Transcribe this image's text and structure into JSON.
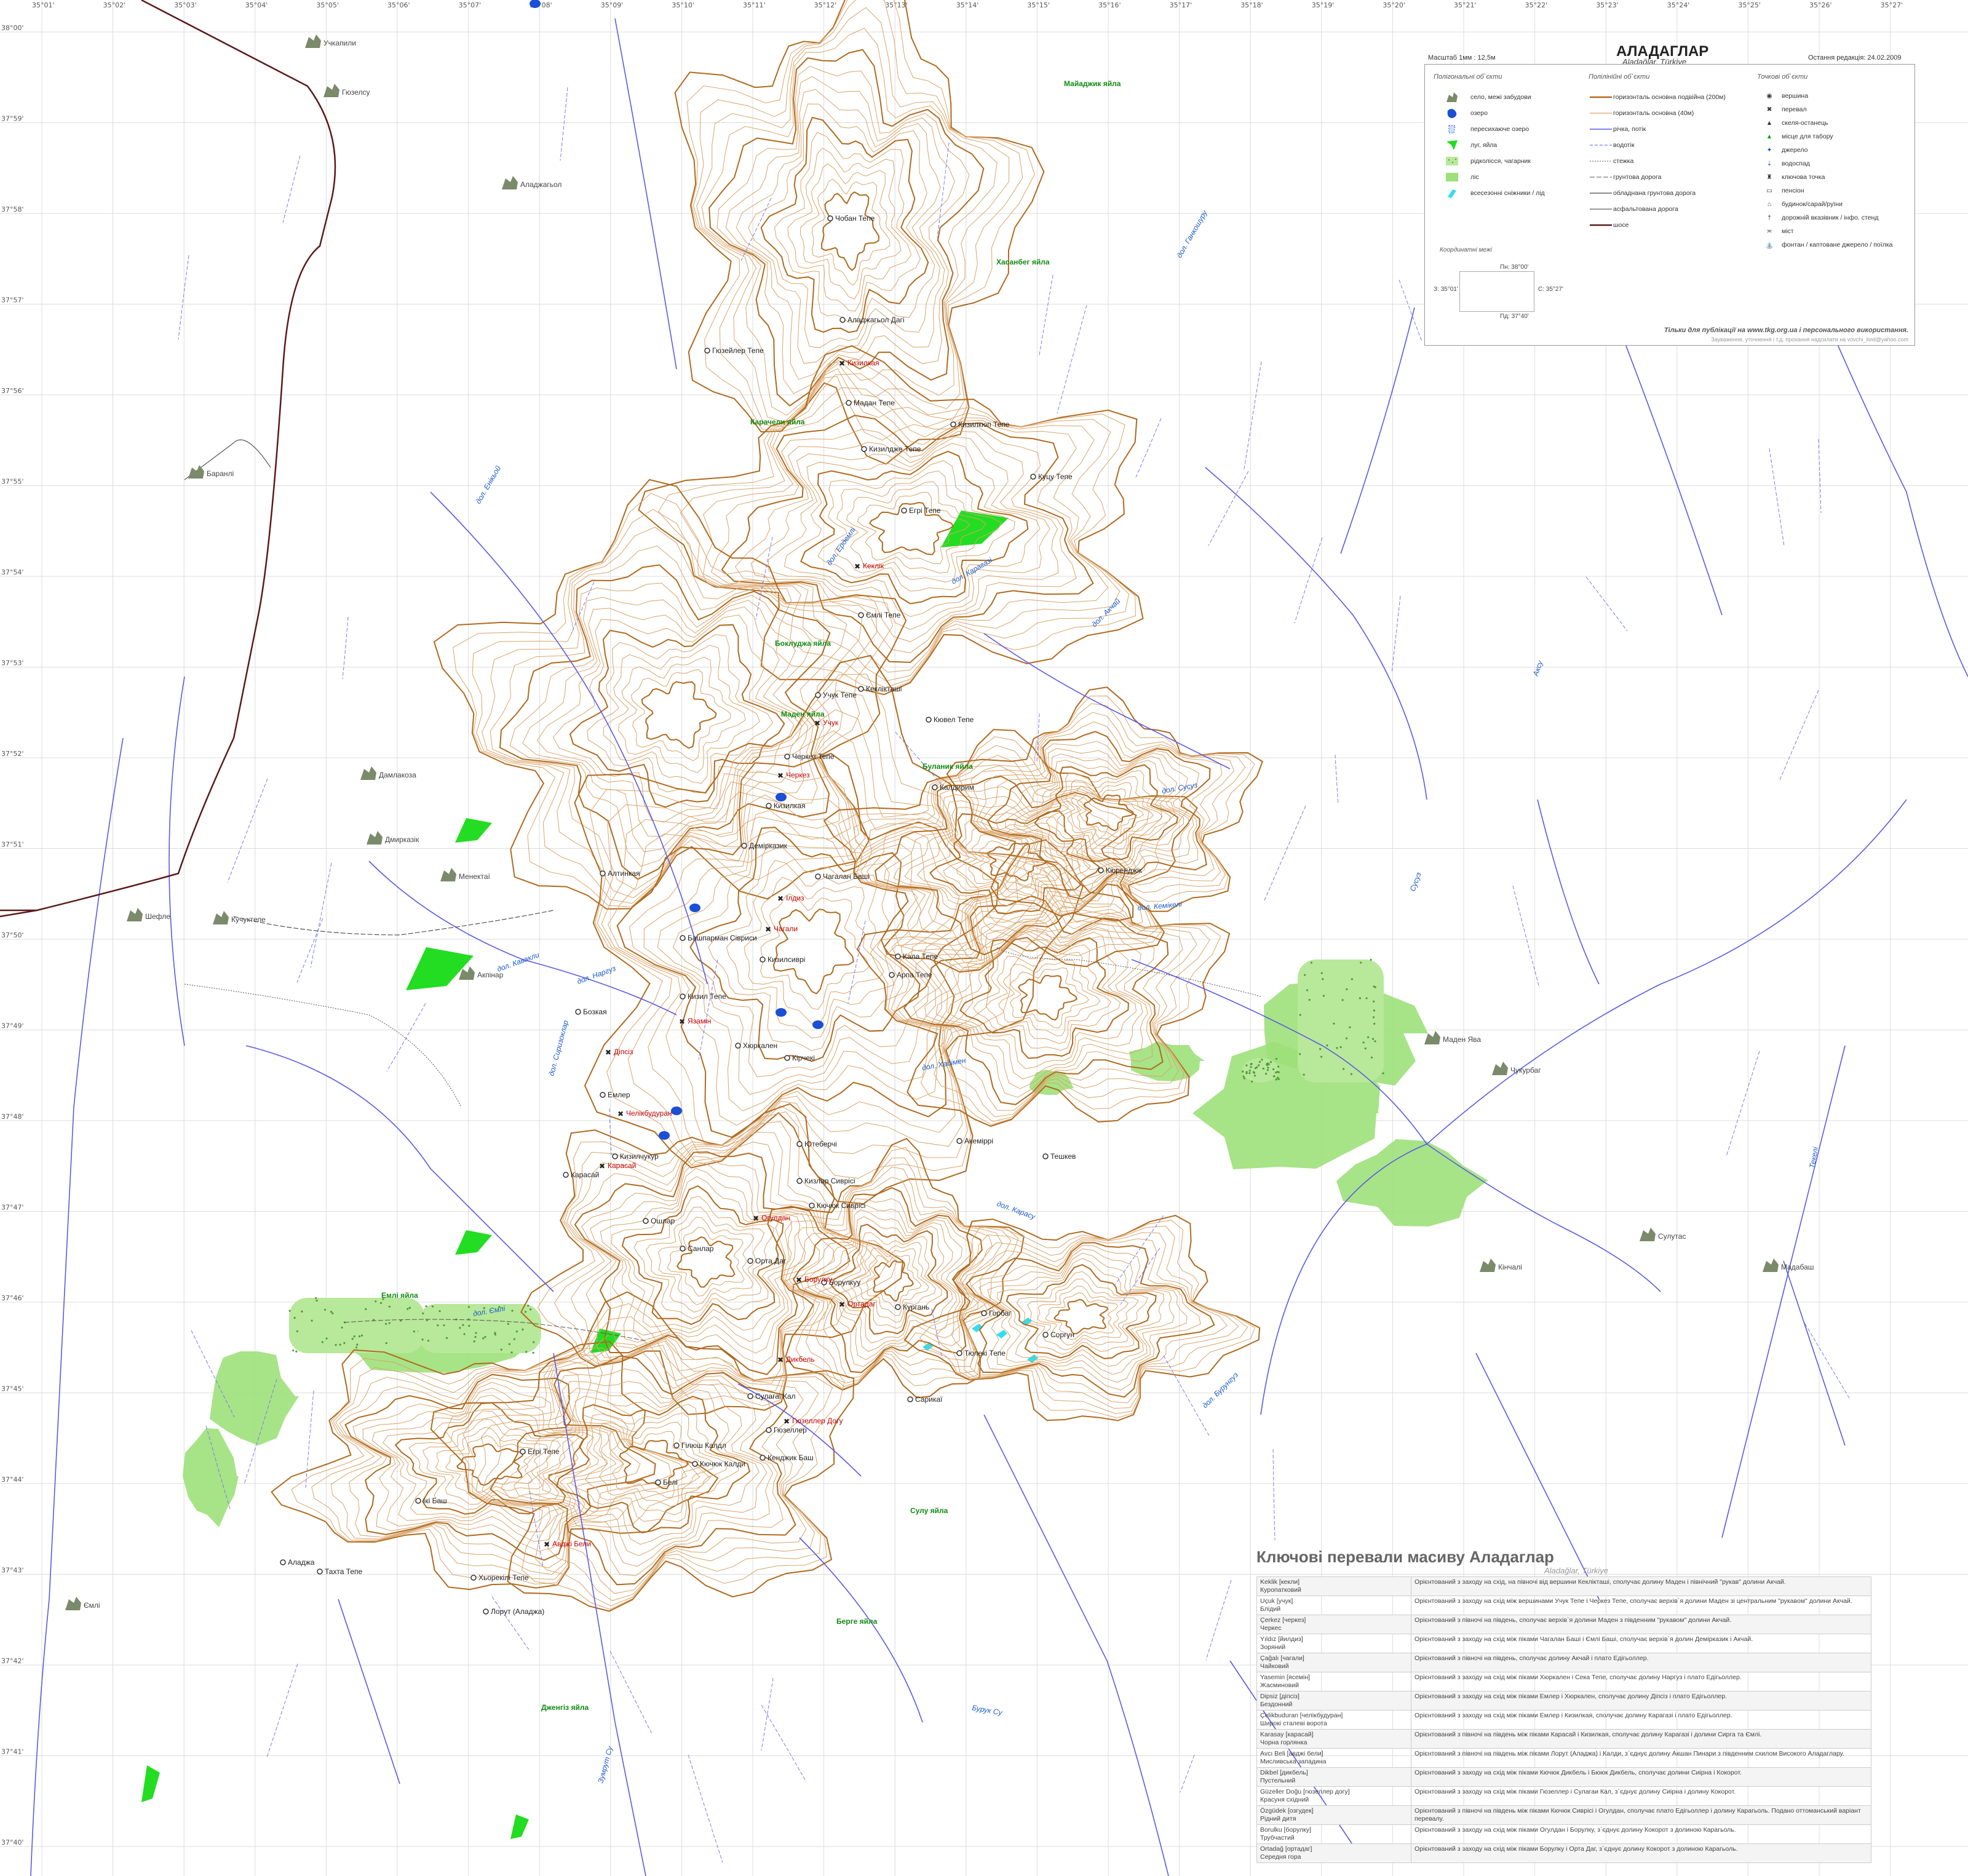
{
  "map": {
    "title": "АЛАДАГЛАР",
    "subtitle": "Aladağlar, Türkiye",
    "scale": "Масштаб 1мм : 12,5м",
    "last_edit": "Остання редакція: 24.02.2009"
  },
  "grid": {
    "top_labels": [
      "35°01'",
      "35°02'",
      "35°03'",
      "35°04'",
      "35°05'",
      "35°06'",
      "35°07'",
      "35°08'",
      "35°09'",
      "35°10'",
      "35°11'",
      "35°12'",
      "35°13'",
      "35°14'",
      "35°15'",
      "35°16'",
      "35°17'",
      "35°18'",
      "35°19'",
      "35°20'",
      "35°21'",
      "35°22'",
      "35°23'",
      "35°24'",
      "35°25'",
      "35°26'",
      "35°27'"
    ],
    "left_labels": [
      "38°00'",
      "37°59'",
      "37°58'",
      "37°57'",
      "37°56'",
      "37°55'",
      "37°54'",
      "37°53'",
      "37°52'",
      "37°51'",
      "37°50'",
      "37°49'",
      "37°48'",
      "37°47'",
      "37°46'",
      "37°45'",
      "37°44'",
      "37°43'",
      "37°42'",
      "37°41'",
      "37°40'"
    ]
  },
  "legend": {
    "polygon_head": "Полігональні об`єкти",
    "line_head": "Полілінійні об`єкти",
    "point_head": "Точкові об`єкти",
    "polygon_items": [
      "село, межі забудови",
      "озеро",
      "пересихаюче озеро",
      "луг, яйла",
      "рідколісся, чагарник",
      "ліс",
      "всесезонні сніжники / лід"
    ],
    "line_items": [
      "горизонталь основна подвійна (200м)",
      "горизонталь основна (40м)",
      "річка, потік",
      "водотік",
      "стежка",
      "грунтова дорога",
      "обладнана грунтова дорога",
      "асфальтована дорога",
      "шосе"
    ],
    "point_items": [
      "вершина",
      "перевал",
      "скеля-останець",
      "місце для табору",
      "джерело",
      "водоспад",
      "ключова точка",
      "пенсіон",
      "будинок/сарай/руїни",
      "дорожній вказівник / інфо. стенд",
      "міст",
      "фонтан / каптоване джерело / поїлка"
    ],
    "coord_head": "Координатні межі",
    "coord_n": "Пн: 38°00'",
    "coord_w": "З: 35°01'",
    "coord_e": "С: 35°27'",
    "coord_s": "Пд: 37°40'",
    "footer1": "Тільки для публікації на www.tkg.org.ua і персонального використання.",
    "footer2": "Зауваження, уточнення і т.д. прохання надсилати на vovchi_livid@yahoo.com",
    "colors": {
      "contour_major": "#b06a1e",
      "contour_minor": "#d9a46a",
      "river": "#5a5ae6",
      "stream": "#7a7af0",
      "highway": "#5a1a1a",
      "meadow": "#22dd22",
      "forest": "#9de07a",
      "shrub": "#b8e89a",
      "lake": "#1a4fd6",
      "snow": "#33ddee"
    }
  },
  "peaks": [
    {
      "name": "Чобан Тепе"
    },
    {
      "name": "Аладжагьол Дагі"
    },
    {
      "name": "Гюзейлер Тепе"
    },
    {
      "name": "Мадан Тепе"
    },
    {
      "name": "Кизилкюп Тепе"
    },
    {
      "name": "Кизилдже Тепе"
    },
    {
      "name": "Куцу Тепе"
    },
    {
      "name": "Егрі Тепе"
    },
    {
      "name": "Ємлі Тепе"
    },
    {
      "name": "Кеклікташі"
    },
    {
      "name": "Учук Тепе"
    },
    {
      "name": "Кювел Тепе"
    },
    {
      "name": "Черкез Тепе"
    },
    {
      "name": "Калдирим"
    },
    {
      "name": "Кизилкая"
    },
    {
      "name": "Демірказик"
    },
    {
      "name": "Алтинкая"
    },
    {
      "name": "Чагалан Баші"
    },
    {
      "name": "Башпарман Сівриси"
    },
    {
      "name": "Кизилсиврі"
    },
    {
      "name": "Кала Тепе"
    },
    {
      "name": "Арпа Тепе"
    },
    {
      "name": "Бозкая"
    },
    {
      "name": "Кизил Тепе"
    },
    {
      "name": "Кюренджік"
    },
    {
      "name": "Емлер"
    },
    {
      "name": "Кірчекі"
    },
    {
      "name": "Хюркален"
    },
    {
      "name": "Акеміррі"
    },
    {
      "name": "Карасай"
    },
    {
      "name": "Кизилчукур"
    },
    {
      "name": "Ютеберчі"
    },
    {
      "name": "Тешкев"
    },
    {
      "name": "Кизлар Сиврісі"
    },
    {
      "name": "Кючюк Сиврісі"
    },
    {
      "name": "Ошлар"
    },
    {
      "name": "Санлар"
    },
    {
      "name": "Орта Даг"
    },
    {
      "name": "Борулкуу"
    },
    {
      "name": "Кургань"
    },
    {
      "name": "Горбаг"
    },
    {
      "name": "Соргун"
    },
    {
      "name": "Сулагаі Кал"
    },
    {
      "name": "Гюзеллер"
    },
    {
      "name": "Кючюк Калди"
    },
    {
      "name": "Белі"
    },
    {
      "name": "Гілюш Калдл"
    },
    {
      "name": "Тюлекі Тепе"
    },
    {
      "name": "Егрі Тепе"
    },
    {
      "name": "Ікі Баш"
    },
    {
      "name": "Хьорекілі Тепе"
    },
    {
      "name": "Лорут (Аладжа)"
    },
    {
      "name": "Аладжа"
    },
    {
      "name": "Тахта Тепе"
    },
    {
      "name": "Кенджик Баш"
    },
    {
      "name": "Сарикаї"
    }
  ],
  "passes": [
    {
      "name": "Кизилкая"
    },
    {
      "name": "Кеклік"
    },
    {
      "name": "Учук"
    },
    {
      "name": "Черкез"
    },
    {
      "name": "Ілдиз"
    },
    {
      "name": "Чагали"
    },
    {
      "name": "Язамін"
    },
    {
      "name": "Діпсіз"
    },
    {
      "name": "Челікбудуран"
    },
    {
      "name": "Карасай"
    },
    {
      "name": "Огулдан"
    },
    {
      "name": "Борулку"
    },
    {
      "name": "Ортадаг"
    },
    {
      "name": "Дикбель"
    },
    {
      "name": "Гюзеллер Догу"
    },
    {
      "name": "Авджі Бели"
    }
  ],
  "rivers": [
    "дол. Кавакли",
    "дол. Енікьой",
    "дол. Ердемлі",
    "дол. Карагазі",
    "дол. Акчай",
    "дол. Ганкошуру",
    "дол. Хадімен",
    "дол. Кемікелі",
    "дол. Наргуз",
    "дол. Сусуз",
    "дол. Сиризоклар",
    "дол. Карасу",
    "дол. Ємлі",
    "дол. Бурунгуз",
    "Аксу",
    "Сусуз",
    "Текелі",
    "Бурук Су",
    "Зумрут Су"
  ],
  "meadows": [
    "Майаджик яйла",
    "Хасанбег яйла",
    "Карачели яйла",
    "Боклуджа яйла",
    "Маден яйла",
    "Буланик яйла",
    "Сулу яйла",
    "Дженгіз яйла",
    "Емлі яйла",
    "Берге яйла"
  ],
  "villages": [
    "Учкапили",
    "Гюзелсу",
    "Баранлі",
    "Дамлакоза",
    "Шефле",
    "Кучуктепе",
    "Дмирказік",
    "Акпінар",
    "Чукурбаг",
    "Мадабаш",
    "Сулутас",
    "Маден Ява",
    "Кінчалі",
    "Менектаї",
    "Ємлі",
    "Аладжагьол"
  ],
  "passes_table": {
    "title": "Ключові перевали масиву Аладаглар",
    "subtitle": "Aladağlar, Türkiye",
    "rows": [
      {
        "name": "Keklik [кекли]\nКуропатковий",
        "desc": "Орієнтований з заходу на схід, на півночі від вершини Кеклікташі, сполучає долину Маден і північний \"рукав\" долини Акчай."
      },
      {
        "name": "Uçuk [учук]\nБлідий",
        "desc": "Орієнтований з заходу на схід між вершинами Учук Тепе і Черкез Тепе, сполучає верхів`я долини Маден зі центральним \"рукавом\" долини Акчай."
      },
      {
        "name": "Çerkez [черкез]\nЧеркес",
        "desc": "Орієнтований з півночі на південь, сполучає верхів`я долини Маден з південним \"рукавом\" долини Акчай."
      },
      {
        "name": "Yıldız [йилдиз]\nЗоряний",
        "desc": "Орієнтований з заходу на схід між піками Чагалан Баші і Ємлі Баші, сполучає верхів`я долин Демірказик і Акчай."
      },
      {
        "name": "Çağalı [чагали]\nЧайковий",
        "desc": "Орієнтований з півночі на південь, сполучає долину Акчай і плато Едігьоллер."
      },
      {
        "name": "Yasemin [ясемін]\nЖасминовий",
        "desc": "Орієнтований з заходу на схід між піками Хюркален і Сека Тепе, сполучає долину Наргуз і плато Едігьоллер."
      },
      {
        "name": "Dipsiz [діпсіз]\nБездонний",
        "desc": "Орієнтований з заходу на схід між піками Емлер і Хюркален, сполучає долину Діпсіз і плато Едігьоллер."
      },
      {
        "name": "Çelikbuduran [челікбудуран]\nШирокі сталеві ворота",
        "desc": "Орієнтований з заходу на схід між піками Емлер і Кизилкая, сполучає долину Карагазі і плато Едігьоллер."
      },
      {
        "name": "Karasay [карасай]\nЧорна горлянка",
        "desc": "Орієнтований з півночі на південь між піками Карасай і Кизилкая, сполучає долину Карагазі і долини Сирга та Ємлі."
      },
      {
        "name": "Avcı Beli [авджі бели]\nМисливська западина",
        "desc": "Орієнтований з півночі на південь між піками Лорут (Аладжа) і Калди, з`єднує долину Акшан Пинари з південним схилом Високого Аладаглару."
      },
      {
        "name": "Dikbel [дикбель]\nПустельний",
        "desc": "Орієнтований з заходу на схід між піками Кючюк Дикбель і Бююк Дикбель, сполучає долини Сиірна і Кокорот."
      },
      {
        "name": "Güzeller Doğu [гюзеллер догу]\nКрасуня східний",
        "desc": "Орієнтований з заходу на схід між піками Гюзеллер і Сулагаи Кал, з`єднує долину Сиірна і долину Кокорот."
      },
      {
        "name": "Özgüdek [озгудек]\nРідний дитя",
        "desc": "Орієнтований з півночі на південь між піками Кючюк Сиврісі і Огулдан, сполучає плато Едігьоллер і долину Карагьоль. Подано оттоманський варіант перевалу."
      },
      {
        "name": "Borulku [борулку]\nТрубчастий",
        "desc": "Орієнтований з заходу на схід між піками Огулдан і Борулку, з`єднує долину Кокорот з долиною Карагьоль."
      },
      {
        "name": "Ortadağ [ортадаг]\nСередня гора",
        "desc": "Орієнтований з заходу на схід між піками Борулку і Орта Даг, з`єднує долину Кокорот з долиною Карагьоль."
      }
    ]
  }
}
